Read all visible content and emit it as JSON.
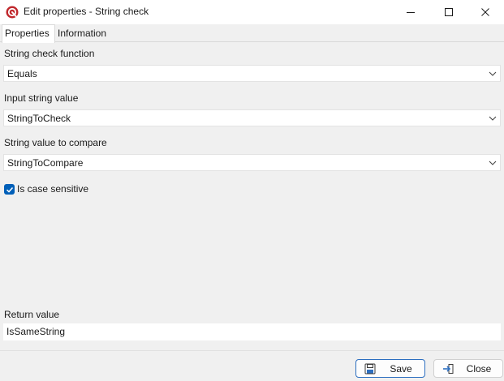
{
  "window": {
    "title": "Edit properties - String check"
  },
  "tabs": [
    {
      "label": "Properties",
      "active": true
    },
    {
      "label": "Information",
      "active": false
    }
  ],
  "form": {
    "string_check_function": {
      "label": "String check function",
      "value": "Equals"
    },
    "input_string_value": {
      "label": "Input string value",
      "value": "StringToCheck"
    },
    "string_value_to_compare": {
      "label": "String value to compare",
      "value": "StringToCompare"
    },
    "is_case_sensitive": {
      "label": "Is case sensitive",
      "checked": true
    },
    "return_value": {
      "label": "Return value",
      "value": "IsSameString"
    }
  },
  "footer": {
    "save_label": "Save",
    "close_label": "Close"
  },
  "colors": {
    "accent": "#005fb8",
    "app_icon": "#c0282d",
    "background": "#f0f0f0"
  }
}
